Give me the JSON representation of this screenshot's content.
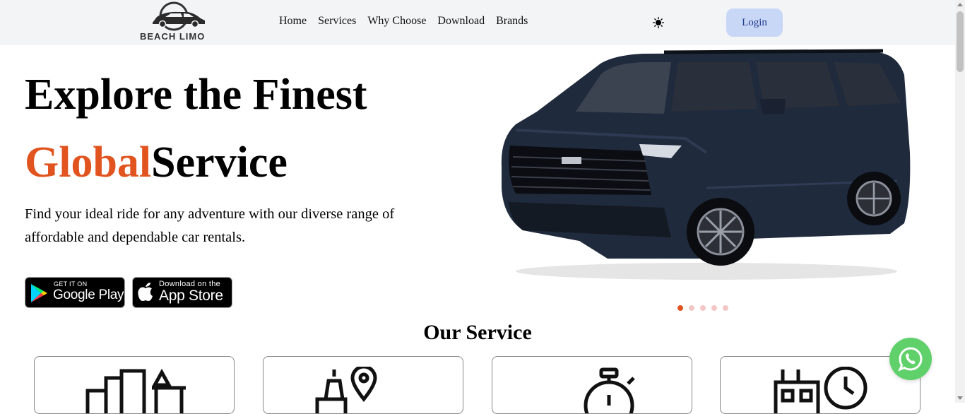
{
  "brand": {
    "logo_text": "BEACH LIMO"
  },
  "nav": {
    "items": [
      "Home",
      "Services",
      "Why Choose",
      "Download",
      "Brands"
    ]
  },
  "header": {
    "login_label": "Login",
    "theme_icon": "sun-icon"
  },
  "hero": {
    "title_line1": "Explore the Finest",
    "title_accent": "Global",
    "title_rest": "Service",
    "description": "Find your ideal ride for any adventure with our diverse range of affordable and dependable car rentals."
  },
  "stores": {
    "google_small": "GET IT ON",
    "google_big": "Google Play",
    "apple_small": "Download on the",
    "apple_big": "App Store"
  },
  "carousel": {
    "total_slides": 5,
    "active_index": 0
  },
  "services": {
    "title": "Our Service",
    "cards": [
      {
        "icon": "city-buildings-icon"
      },
      {
        "icon": "landmark-location-icon"
      },
      {
        "icon": "stopwatch-icon"
      },
      {
        "icon": "hourly-clock-icon"
      }
    ]
  },
  "colors": {
    "accent": "#e2541f",
    "login_bg": "#c9d7f7",
    "nav_bg": "#f3f4f6",
    "whatsapp": "#5fd06a"
  }
}
